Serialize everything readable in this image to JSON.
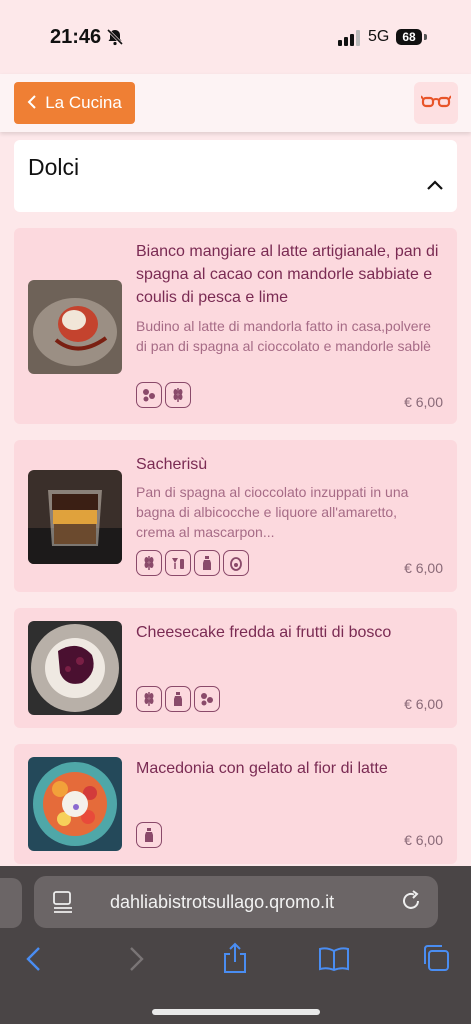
{
  "status_bar": {
    "time": "21:46",
    "network": "5G",
    "battery": "68"
  },
  "header": {
    "back_label": "La Cucina"
  },
  "section": {
    "title": "Dolci"
  },
  "items": [
    {
      "name": "Bianco mangiare al latte artigianale, pan di spagna al cacao con mandorle sabbiate e coulis di pesca e lime",
      "description": "Budino al latte di mandorla fatto in casa,polvere di pan di spagna al cioccolato e mandorle sablè",
      "price": "€ 6,00",
      "allergens": [
        "nuts-icon",
        "gluten-icon"
      ]
    },
    {
      "name": "Sacherisù",
      "description": "Pan di spagna al cioccolato inzuppati in una bagna di albicocche e liquore all'amaretto, crema al mascarpon...",
      "price": "€ 6,00",
      "allergens": [
        "gluten-icon",
        "alcohol-icon",
        "milk-icon",
        "egg-icon"
      ]
    },
    {
      "name": "Cheesecake fredda ai frutti di bosco",
      "description": "",
      "price": "€ 6,00",
      "allergens": [
        "gluten-icon",
        "milk-icon",
        "nuts-icon"
      ]
    },
    {
      "name": "Macedonia con gelato al fior di latte",
      "description": "",
      "price": "€ 6,00",
      "allergens": [
        "milk-icon"
      ]
    }
  ],
  "browser": {
    "url": "dahliabistrotsullago.qromo.it"
  }
}
